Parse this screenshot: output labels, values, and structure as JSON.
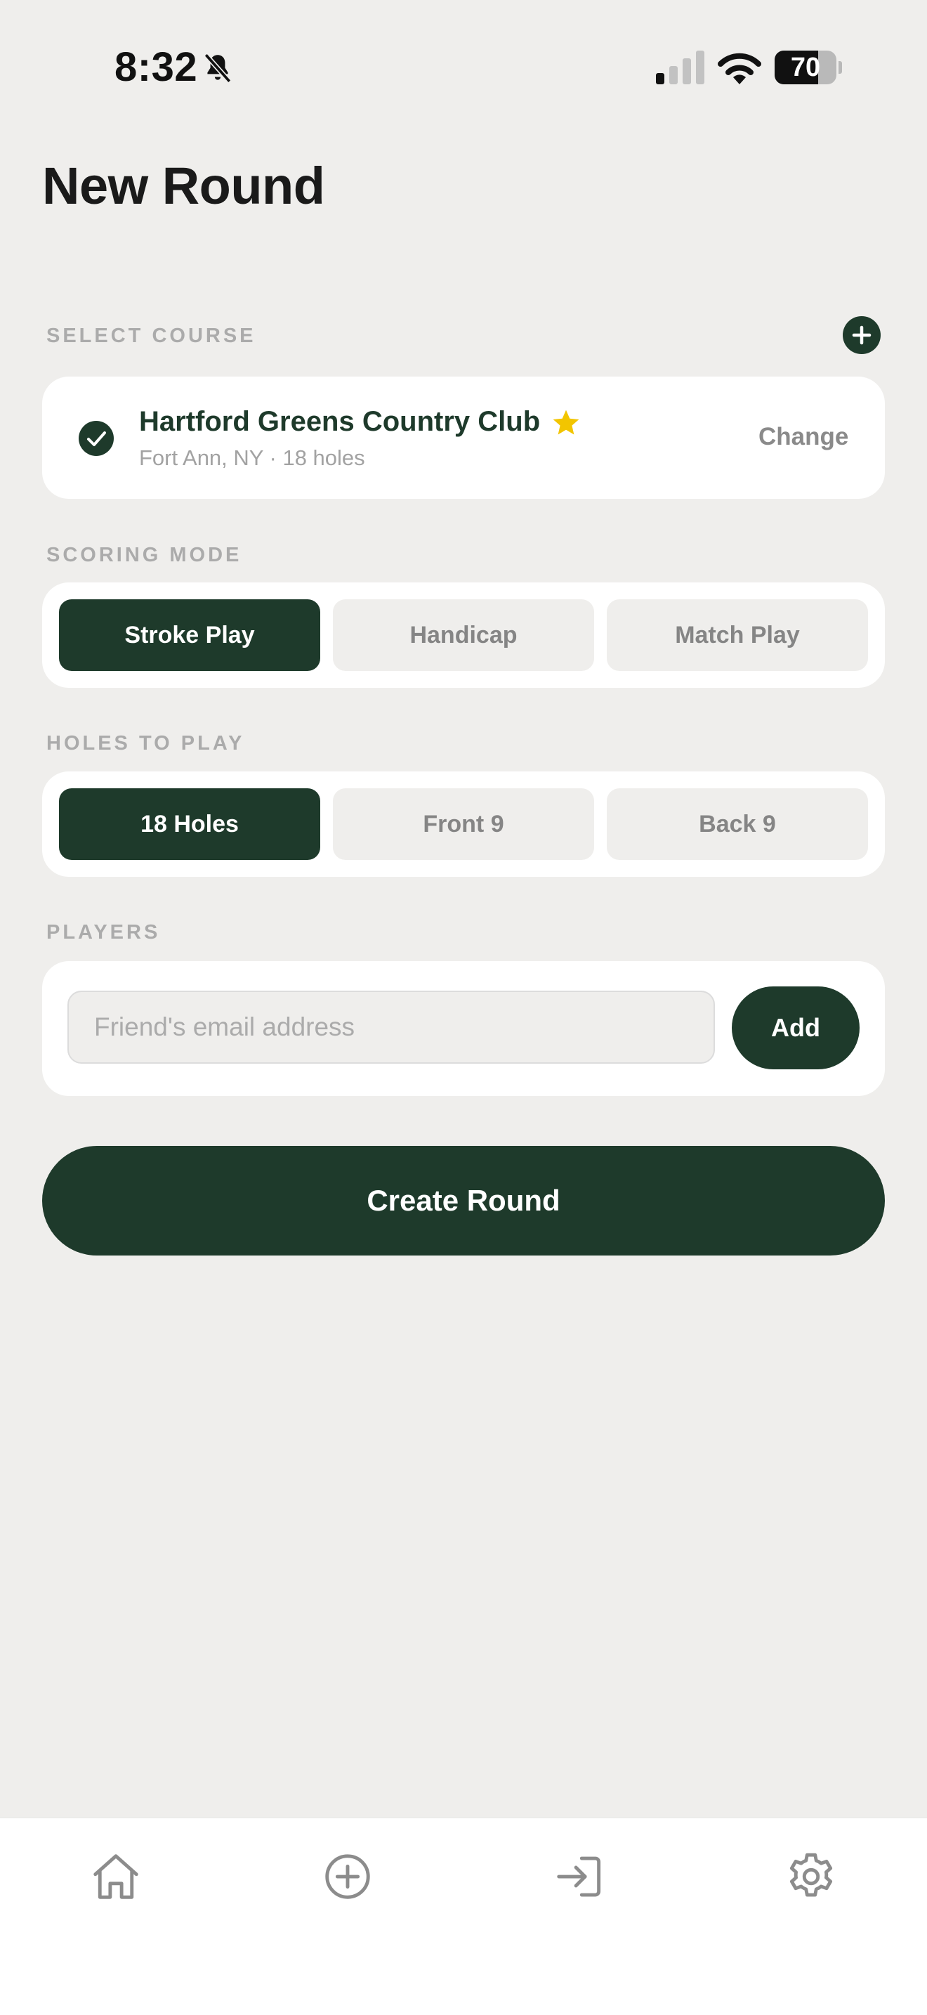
{
  "status_bar": {
    "time": "8:32",
    "battery_percent": 70,
    "battery_label": "70"
  },
  "page": {
    "title": "New Round"
  },
  "course": {
    "section_label": "SELECT COURSE",
    "name": "Hartford Greens Country Club",
    "meta": "Fort Ann, NY · 18 holes",
    "change_label": "Change",
    "favorite": true,
    "selected": true
  },
  "scoring_mode": {
    "section_label": "SCORING MODE",
    "options": [
      "Stroke Play",
      "Handicap",
      "Match Play"
    ],
    "selected": "Stroke Play"
  },
  "holes": {
    "section_label": "HOLES TO PLAY",
    "options": [
      "18 Holes",
      "Front 9",
      "Back 9"
    ],
    "selected": "18 Holes"
  },
  "players": {
    "section_label": "PLAYERS",
    "email_placeholder": "Friend's email address",
    "email_value": "",
    "add_label": "Add"
  },
  "actions": {
    "create_label": "Create Round"
  },
  "tab_bar": {
    "items": [
      {
        "icon": "home-icon"
      },
      {
        "icon": "plus-circle-icon"
      },
      {
        "icon": "join-arrow-icon"
      },
      {
        "icon": "gear-icon"
      }
    ]
  },
  "colors": {
    "brand": "#1e3a2b",
    "background": "#efeeec",
    "star": "#f2c500",
    "muted": "#ababab"
  }
}
